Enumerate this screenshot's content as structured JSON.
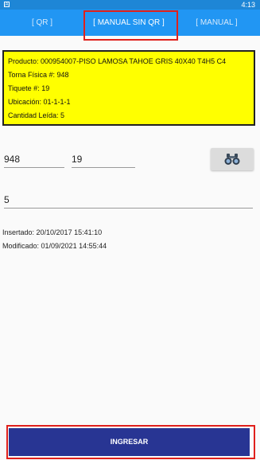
{
  "status_bar": {
    "time": "4:13",
    "system_icon": "a-notification-icon",
    "system_glyph": "A"
  },
  "tabs": [
    {
      "label": "[ QR ]",
      "active": false
    },
    {
      "label": "[ MANUAL SIN QR ]",
      "active": true
    },
    {
      "label": "[ MANUAL ]",
      "active": false
    }
  ],
  "product_info": {
    "producto": "Producto: 000954007-PISO LAMOSA TAHOE GRIS 40X40 T4H5 C4",
    "torna": "Torna Física #: 948",
    "tiquete": "Tiquete #: 19",
    "ubicacion": "Ubicación: 01-1-1-1",
    "cantidad": "Cantidad Leída: 5"
  },
  "inputs": {
    "torna_value": "948",
    "tiquete_value": "19",
    "cantidad_value": "5"
  },
  "search_button": {
    "icon": "binoculars-icon"
  },
  "meta": {
    "inserted": "Insertado: 20/10/2017 15:41:10",
    "modified": "Modificado: 01/09/2021 14:55:44"
  },
  "submit_button": {
    "label": "INGRESAR"
  },
  "colors": {
    "status_bar": "#1e86d6",
    "tab_bar": "#2196f3",
    "info_card": "#ffff00",
    "submit_button": "#283593",
    "highlight": "#e0201b"
  }
}
